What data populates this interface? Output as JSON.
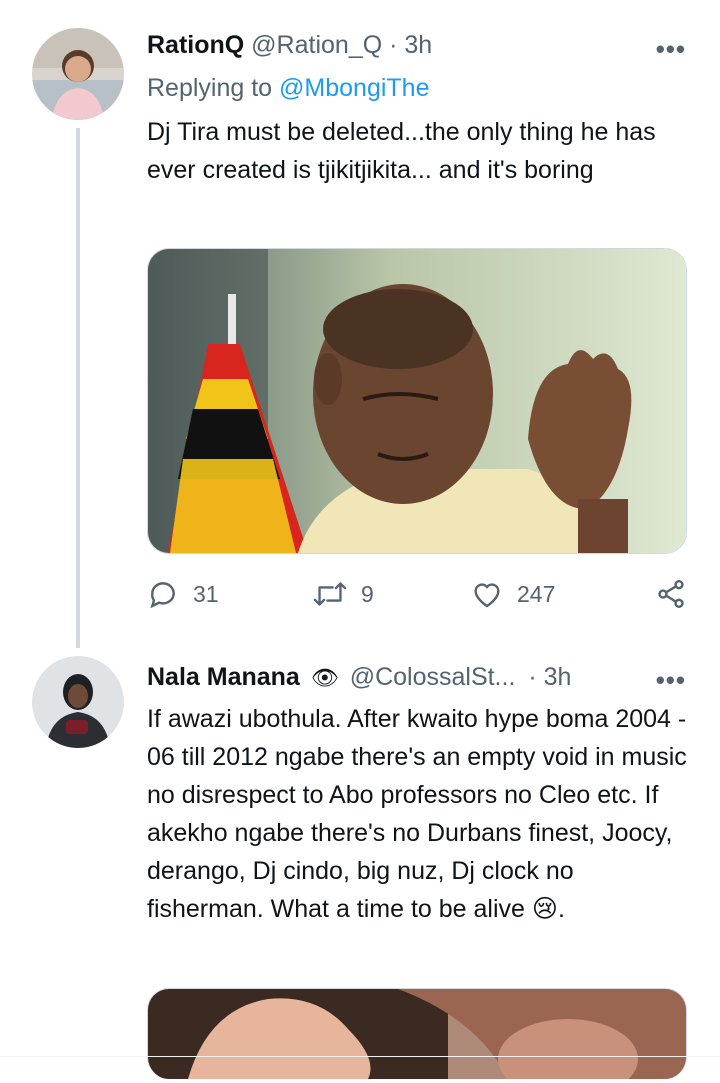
{
  "tweets": [
    {
      "name": "RationQ",
      "handle": "@Ration_Q",
      "separator": "·",
      "time": "3h",
      "replying_prefix": "Replying to",
      "replying_to": "@MbongiThe",
      "text": "Dj Tira must be deleted...the only thing he has ever created is tjikitjikita... and it's boring",
      "stats": {
        "replies": "31",
        "retweets": "9",
        "likes": "247"
      }
    },
    {
      "name": "Nala Manana",
      "name_emoji": "👁",
      "handle": "@ColossalSt...",
      "separator": "·",
      "time": "3h",
      "text": "If awazi ubothula. After kwaito hype boma 2004 - 06 till 2012 ngabe there's an empty void in music no disrespect to Abo professors no Cleo etc. If akekho ngabe there's no Durbans finest, Joocy, derango, Dj cindo, big nuz, Dj clock no fisherman. What a time to be alive 😢."
    }
  ],
  "icons": {
    "more": "more-horizontal-icon",
    "reply": "reply-bubble-icon",
    "retweet": "retweet-arrows-icon",
    "like": "heart-outline-icon",
    "share": "share-nodes-icon"
  },
  "colors": {
    "text": "#0f1419",
    "secondary": "#536471",
    "link": "#1d9bf0",
    "thread_line": "#cfd9de"
  }
}
